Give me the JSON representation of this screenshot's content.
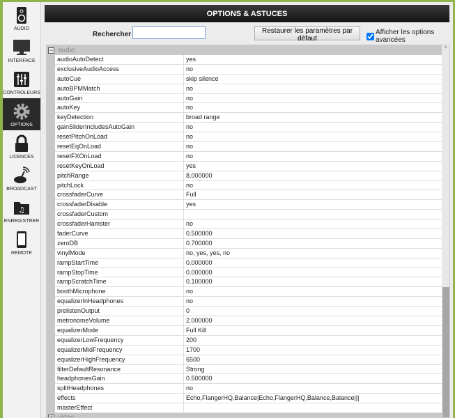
{
  "sidebar": {
    "items": [
      {
        "label": "AUDIO",
        "icon": "speaker-icon"
      },
      {
        "label": "INTERFACE",
        "icon": "monitor-icon"
      },
      {
        "label": "CONTROLEURS",
        "icon": "sliders-icon"
      },
      {
        "label": "OPTIONS",
        "icon": "gear-icon",
        "active": true
      },
      {
        "label": "LICENCES",
        "icon": "lock-icon"
      },
      {
        "label": "BROADCAST",
        "icon": "broadcast-icon"
      },
      {
        "label": "ENREGISTRER",
        "icon": "folder-music-icon"
      },
      {
        "label": "REMOTE",
        "icon": "tablet-icon"
      }
    ]
  },
  "header": {
    "title": "OPTIONS & ASTUCES"
  },
  "toolbar": {
    "search_label": "Rechercher :",
    "search_value": "",
    "restore_label": "Restaurer les paramètres par défaut",
    "advanced_label": "Afficher les options avancées",
    "advanced_checked": true
  },
  "groups": {
    "audio": "audio",
    "video": "video"
  },
  "rows": [
    [
      "audioAutoDetect",
      "yes"
    ],
    [
      "exclusiveAudioAccess",
      "no"
    ],
    [
      "autoCue",
      "skip silence"
    ],
    [
      "autoBPMMatch",
      "no"
    ],
    [
      "autoGain",
      "no"
    ],
    [
      "autoKey",
      "no"
    ],
    [
      "keyDetection",
      "broad range"
    ],
    [
      "gainSliderIncludesAutoGain",
      "no"
    ],
    [
      "resetPitchOnLoad",
      "no"
    ],
    [
      "resetEqOnLoad",
      "no"
    ],
    [
      "resetFXOnLoad",
      "no"
    ],
    [
      "resetKeyOnLoad",
      "yes"
    ],
    [
      "pitchRange",
      "8.000000"
    ],
    [
      "pitchLock",
      "no"
    ],
    [
      "crossfaderCurve",
      "Full"
    ],
    [
      "crossfaderDisable",
      "yes"
    ],
    [
      "crossfaderCustom",
      ""
    ],
    [
      "crossfaderHamster",
      "no"
    ],
    [
      "faderCurve",
      "0.500000"
    ],
    [
      "zeroDB",
      "0.700000"
    ],
    [
      "vinylMode",
      "no, yes, yes, no"
    ],
    [
      "rampStartTime",
      "0.000000"
    ],
    [
      "rampStopTime",
      "0.000000"
    ],
    [
      "rampScratchTime",
      "0.100000"
    ],
    [
      "boothMicrophone",
      "no"
    ],
    [
      "equalizerInHeadphones",
      "no"
    ],
    [
      "prelistenOutput",
      "0"
    ],
    [
      "metronomeVolume",
      "2.000000"
    ],
    [
      "equalizerMode",
      "Full Kill"
    ],
    [
      "equalizerLowFrequency",
      "200"
    ],
    [
      "equalizerMidFrequency",
      "1700"
    ],
    [
      "equalizerHighFrequency",
      "6500"
    ],
    [
      "filterDefaultResonance",
      "Strong"
    ],
    [
      "headphonesGain",
      "0.500000"
    ],
    [
      "splitHeadphones",
      "no"
    ],
    [
      "effects",
      "Echo,FlangerHQ,Balance|Echo,FlangerHQ,Balance,Balance|||"
    ],
    [
      "masterEffect",
      ""
    ]
  ]
}
